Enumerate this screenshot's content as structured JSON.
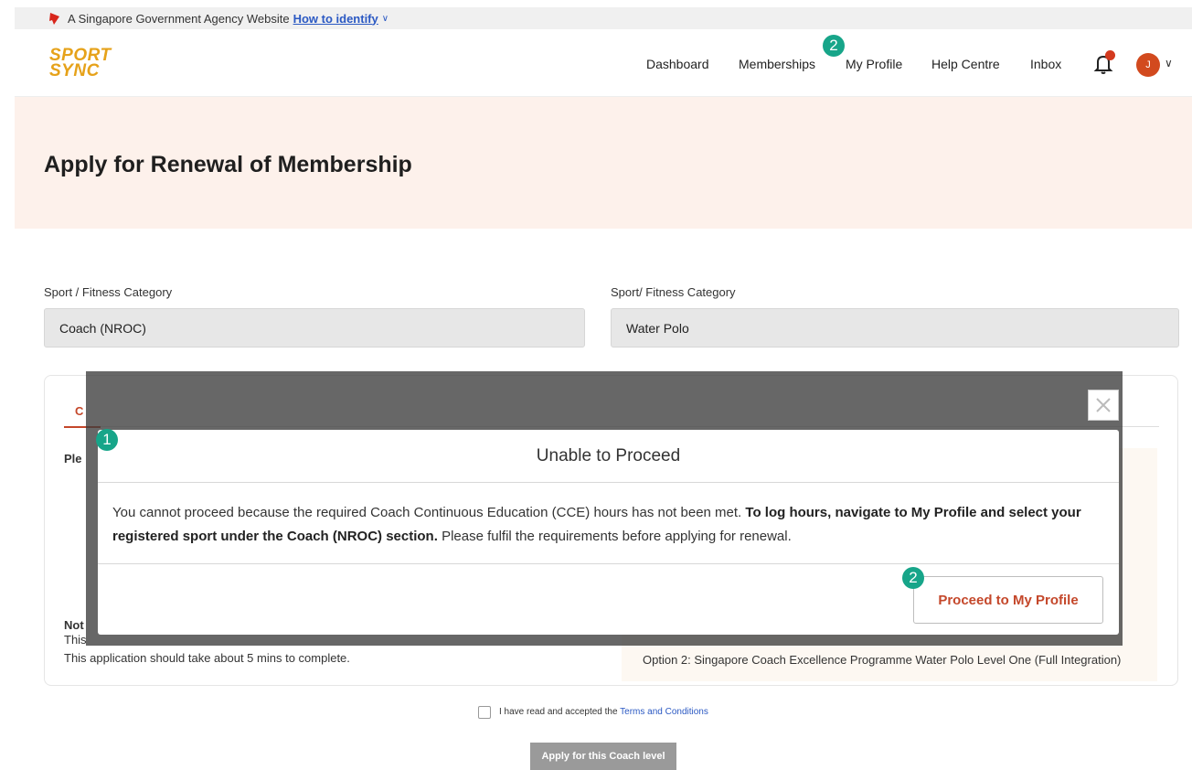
{
  "gov_banner": {
    "text": "A Singapore Government Agency Website",
    "link": "How to identify"
  },
  "header": {
    "logo_line1": "SPORT",
    "logo_line2": "SYNC",
    "nav": [
      "Dashboard",
      "Memberships",
      "My Profile",
      "Help Centre",
      "Inbox"
    ],
    "avatar_initial": "J"
  },
  "hero": {
    "title": "Apply for Renewal of Membership"
  },
  "form": {
    "field1_label": "Sport / Fitness Category",
    "field1_value": "Coach (NROC)",
    "field2_label": "Sport/ Fitness Category",
    "field2_value": "Water Polo"
  },
  "card": {
    "tab_fragment": "C",
    "please_fragment": "Ple",
    "note_fragment": "Not",
    "this_fragment": "This",
    "duration_text": "This application should take about 5 mins to complete.",
    "option2_text": "Option 2: Singapore Coach Excellence Programme Water Polo Level One (Full Integration)"
  },
  "terms": {
    "text": "I have read and accepted the",
    "link": "Terms and Conditions"
  },
  "apply_button": "Apply for this Coach level",
  "modal": {
    "title": "Unable to Proceed",
    "body_part1": "You cannot proceed because the required Coach Continuous Education (CCE) hours has not been met.",
    "body_bold": "To log hours, navigate to My Profile and select your registered sport under the Coach (NROC) section.",
    "body_part2": "Please fulfil the requirements before applying for renewal.",
    "proceed_label": "Proceed to My Profile"
  },
  "markers": {
    "one": "1",
    "two": "2"
  },
  "colors": {
    "accent": "#c4472a",
    "logo": "#e6a21a",
    "marker": "#17a589",
    "hero_bg": "#fdf1eb"
  }
}
